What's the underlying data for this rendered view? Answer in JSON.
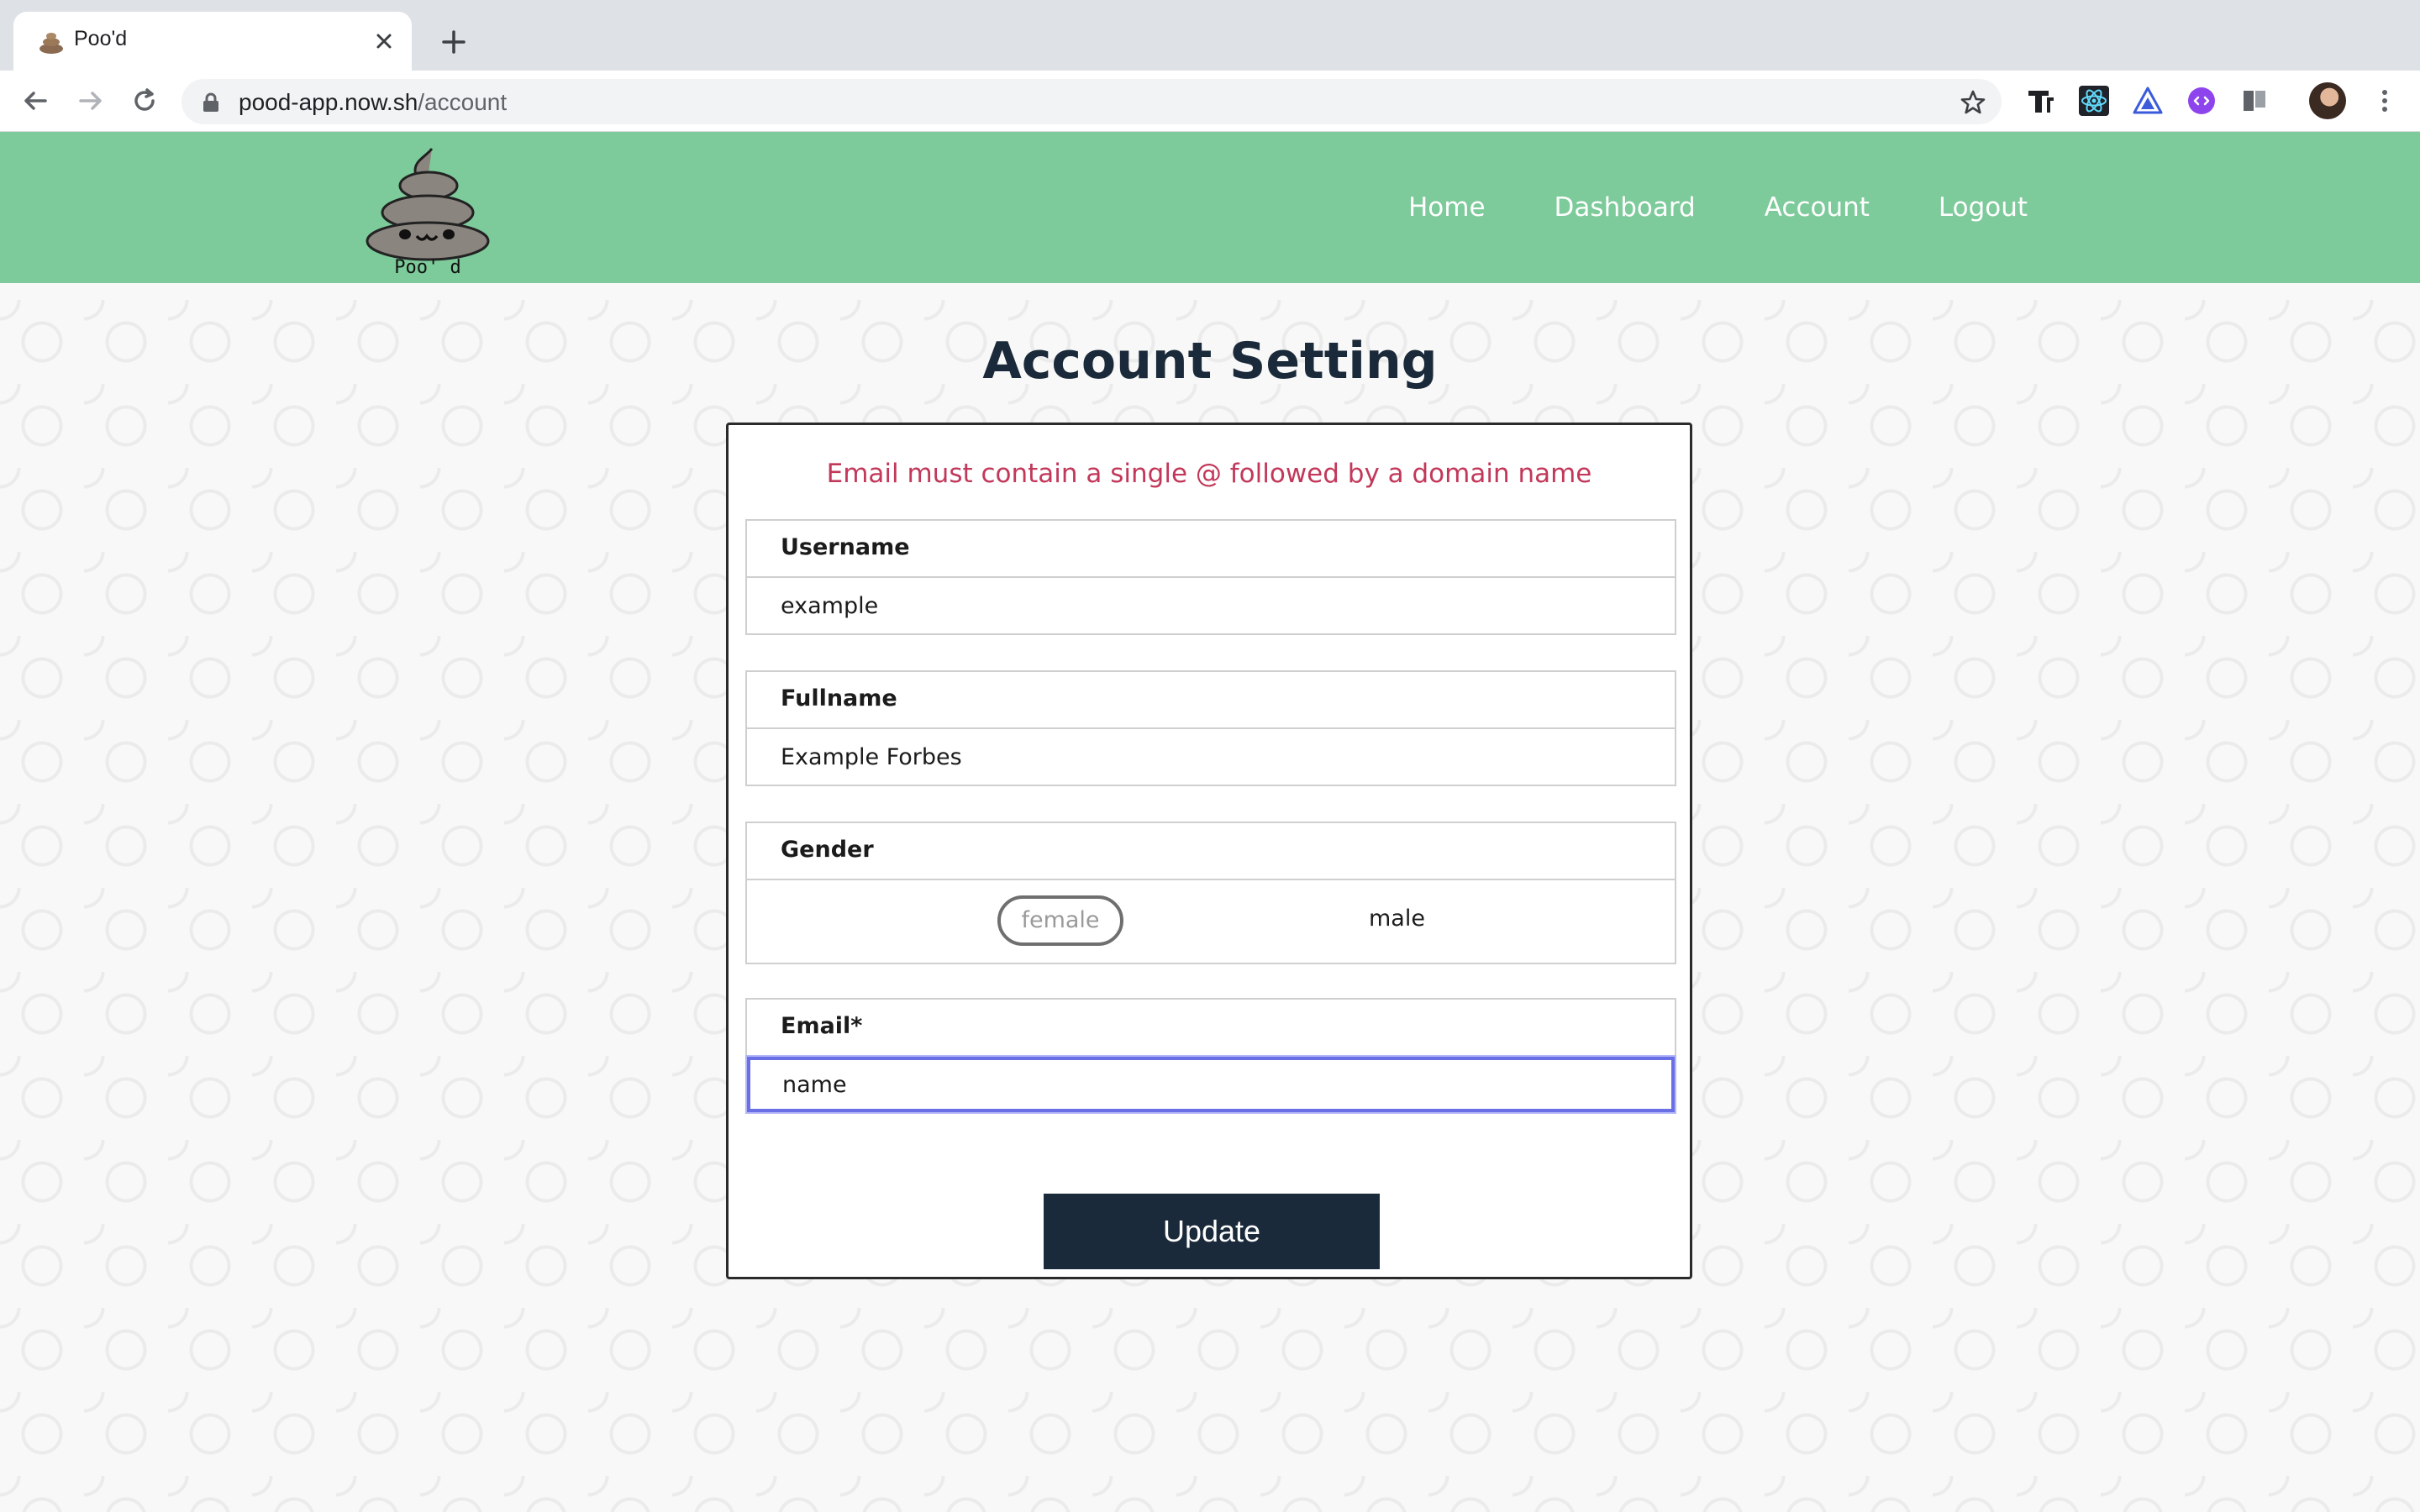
{
  "browser": {
    "tab_title": "Poo'd",
    "url_host": "pood-app.now.sh",
    "url_path": "/account"
  },
  "header": {
    "logo_text": "Poo' d",
    "nav": [
      "Home",
      "Dashboard",
      "Account",
      "Logout"
    ]
  },
  "main": {
    "title": "Account Setting",
    "error_message": "Email must contain a single @ followed by a domain name",
    "fields": {
      "username": {
        "label": "Username",
        "value": "example"
      },
      "fullname": {
        "label": "Fullname",
        "value": "Example Forbes"
      },
      "gender": {
        "label": "Gender",
        "options": [
          "female",
          "male"
        ],
        "selected": ""
      },
      "email": {
        "label": "Email*",
        "value": "name"
      }
    },
    "submit_label": "Update"
  },
  "colors": {
    "header_bg": "#7dca9a",
    "error": "#c2385a",
    "button_bg": "#1b2a3a",
    "focus_ring": "#6a6fe6"
  }
}
